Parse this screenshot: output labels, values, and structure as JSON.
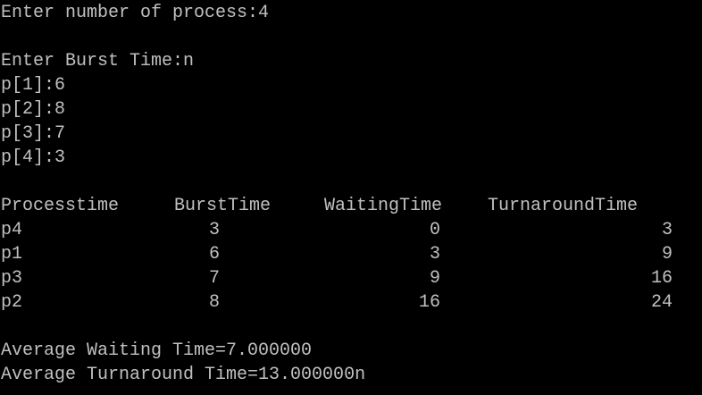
{
  "console": {
    "colors": {
      "background": "#000000",
      "text": "#c0c0c0"
    },
    "prompt_process_count": "Enter number of process:4",
    "prompt_burst": "Enter Burst Time:n",
    "burst_inputs": [
      "p[1]:6",
      "p[2]:8",
      "p[3]:7",
      "p[4]:3"
    ],
    "table": {
      "headers": [
        "Processtime",
        "BurstTime",
        "WaitingTime",
        "TurnaroundTime"
      ],
      "rows": [
        [
          "p4",
          "3",
          "0",
          "3"
        ],
        [
          "p1",
          "6",
          "3",
          "9"
        ],
        [
          "p3",
          "7",
          "9",
          "16"
        ],
        [
          "p2",
          "8",
          "16",
          "24"
        ]
      ]
    },
    "avg_waiting": "Average Waiting Time=7.000000",
    "avg_turnaround": "Average Turnaround Time=13.000000n"
  }
}
